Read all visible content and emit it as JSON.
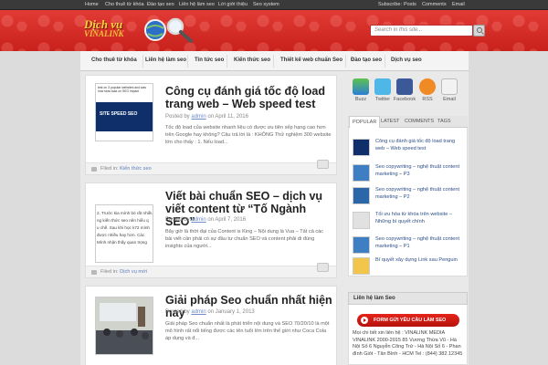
{
  "topbar": {
    "left_links": [
      "Home",
      "Cho thuê từ khóa",
      "Đào tạo seo",
      "Liên hệ làm seo",
      "Lời giới thiệu",
      "Seo system"
    ],
    "right_links": [
      "Subscribe:",
      "Posts",
      "Comments",
      "Email"
    ]
  },
  "header": {
    "logo_line1": "Dịch vụ",
    "logo_line2": "VINALINK",
    "search_placeholder": "Search in this site..."
  },
  "nav": {
    "items": [
      "Cho thuê từ khóa",
      "Liên hệ làm seo",
      "Tin tức seo",
      "Kiến thức seo",
      "Thiết kế web chuẩn Seo",
      "Đào tạo seo",
      "Dịch vụ seo"
    ]
  },
  "posts": [
    {
      "title": "Công cụ đánh giá tốc độ load trang web – Web speed test",
      "meta_prefix": "Posted by",
      "author": "admin",
      "date": "on April 11, 2016",
      "excerpt": "Tốc độ load của website nhanh liệu có được ưu tiên xếp hạng cao hơn trên Google hay không? Câu trả lời là : KHÔNG Thử nghiệm 300 website lớn cho thấy : 1. Nếu load...",
      "thumb_text": "SITE SPEED SEO",
      "thumb_caption": "test on 3 popular websites and saw how slow load on SEO impact",
      "filed_prefix": "Filed in:",
      "category": "Kiến thức seo"
    },
    {
      "title": "Viết bài chuẩn SEO – dịch vụ viết content từ “Tố Ngành SEO”",
      "meta_prefix": "Posted by",
      "author": "admin",
      "date": "on April 7, 2016",
      "excerpt": "Bây giờ là thời đại của Content is King – Nội dung là Vua – Tất cả các bài viết cần phải có sự đầu tư chuẩn SEO và content phải di đúng insights của người...",
      "thumb_lines": [
        "2. Trước kia mình bỏ rất nhiều",
        "ng kiến thức seo nên hiểu q",
        "u chế. Sau khi học k72 mình",
        "được nhiều hay hơn. Các",
        "Mình nhận thấy quan trọng"
      ],
      "filed_prefix": "Filed in:",
      "category": "Dịch vụ mới"
    },
    {
      "title": "Giải pháp Seo chuẩn nhất hiện nay",
      "meta_prefix": "Posted by",
      "author": "admin",
      "date": "on January 1, 2013",
      "excerpt": "Giải pháp Seo chuẩn nhất là phát triển nội dung và SEO 70/20/10 là một mô hình rất nổi tiếng được các tên tuổi lớn trên thế giới như Coca Cola áp dụng và đ..."
    }
  ],
  "sidebar": {
    "social": [
      "Buzz",
      "Twitter",
      "Facebook",
      "RSS",
      "Email"
    ],
    "tabs": [
      "POPULAR",
      "LATEST",
      "COMMENTS",
      "TAGS"
    ],
    "popular": [
      "Công cụ đánh giá tốc độ load trang web – Web speed test",
      "Seo copywriting – nghệ thuật content marketing – P3",
      "Seo copywriting – nghệ thuật content marketing – P2",
      "Tối ưu hóa từ khóa trên website – Những bí quyết chính",
      "Seo copywriting – nghệ thuật content marketing – P1",
      "Bí quyết xây dựng Link sau Penguin"
    ],
    "contact_title": "Liên hệ làm Seo",
    "form_banner": "FORM GỬI YÊU CẦU LÀM SEO",
    "contact_text": "Mọi chi tiết xin liên hệ : VINALINK MEDIA VINALINK 2000-2015 85 Vương Thừa Vũ - Hà Nội Số 6 Nguyễn Công Trứ - Hà Nội Số 6 - Phan đình Giót - Tân Bình - HCM Tel : (844) 382.12345"
  },
  "colors": {
    "header_red": "#d42a24",
    "link_blue": "#2d4f8a",
    "logo_yellow": "#f7d23a"
  }
}
